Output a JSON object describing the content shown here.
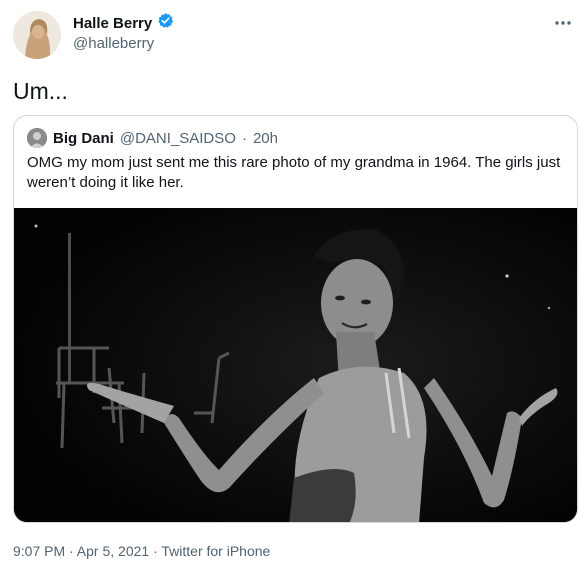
{
  "author": {
    "display_name": "Halle Berry",
    "handle": "@halleberry",
    "verified_icon": "verified-badge-icon"
  },
  "menu_icon": "more-options-icon",
  "tweet": {
    "text": "Um...",
    "footer": "9:07 PM · Apr 5, 2021 · Twitter for iPhone"
  },
  "quoted": {
    "display_name": "Big Dani",
    "handle": "@DANI_SAIDSO",
    "separator": "·",
    "time": "20h",
    "text": "OMG my mom just sent me this rare photo of my grandma in 1964. The girls just weren’t doing it like her."
  },
  "colors": {
    "verified": "#1d9bf0",
    "secondary_text": "#536471",
    "border": "#cfd9de"
  }
}
